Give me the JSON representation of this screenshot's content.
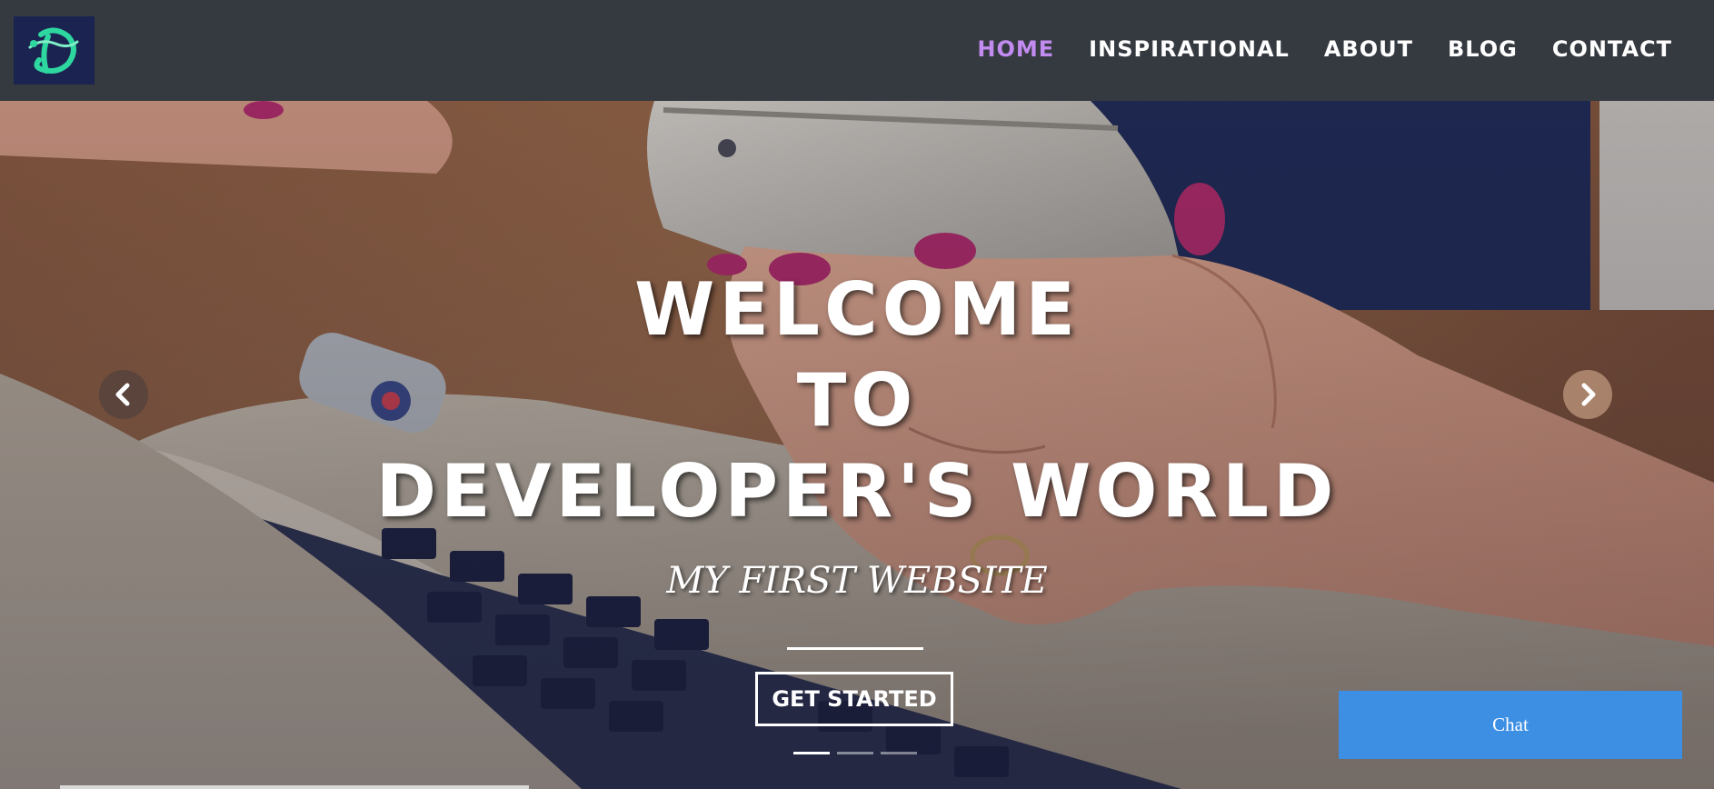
{
  "nav": {
    "logo_icon": "d-monogram-logo",
    "items": [
      {
        "label": "HOME",
        "active": true
      },
      {
        "label": "INSPIRATIONAL",
        "active": false
      },
      {
        "label": "ABOUT",
        "active": false
      },
      {
        "label": "BLOG",
        "active": false
      },
      {
        "label": "CONTACT",
        "active": false
      }
    ],
    "active_color": "#c28bf0"
  },
  "hero": {
    "title_lines": [
      "WELCOME",
      "TO",
      "DEVELOPER'S WORLD"
    ],
    "subtitle": "MY FIRST WEBSITE",
    "cta_label": "GET STARTED",
    "prev_icon": "chevron-left-icon",
    "next_icon": "chevron-right-icon",
    "slides": 3,
    "active_slide": 1
  },
  "chat": {
    "label": "Chat",
    "color": "#3d8fe4"
  }
}
